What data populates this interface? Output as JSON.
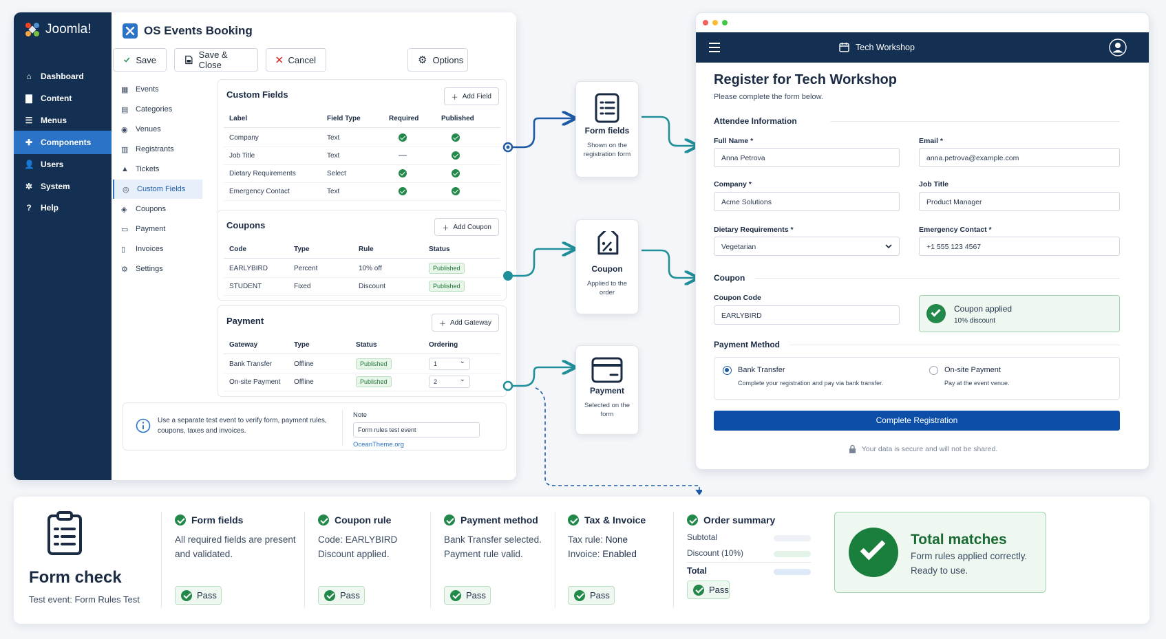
{
  "admin": {
    "brand": "Joomla!",
    "title": "OS Events Booking",
    "sidebar": [
      {
        "label": "Dashboard",
        "icon": "home-icon"
      },
      {
        "label": "Content",
        "icon": "file-icon"
      },
      {
        "label": "Menus",
        "icon": "list-icon"
      },
      {
        "label": "Components",
        "icon": "puzzle-icon",
        "active": true
      },
      {
        "label": "Users",
        "icon": "users-icon"
      },
      {
        "label": "System",
        "icon": "wrench-icon"
      },
      {
        "label": "Help",
        "icon": "question-icon"
      }
    ],
    "toolbar": {
      "save": "Save",
      "save_close": "Save & Close",
      "cancel": "Cancel",
      "options": "Options"
    },
    "nav": [
      "Events",
      "Categories",
      "Venues",
      "Registrants",
      "Tickets",
      "Custom Fields",
      "Coupons",
      "Payment",
      "Invoices",
      "Settings"
    ],
    "nav_active": "Custom Fields",
    "custom_fields": {
      "title": "Custom Fields",
      "add_button": "Add Field",
      "headers": [
        "Label",
        "Field Type",
        "Required",
        "Published"
      ],
      "rows": [
        {
          "label": "Company",
          "type": "Text",
          "required": true,
          "published": true
        },
        {
          "label": "Job Title",
          "type": "Text",
          "required": false,
          "published": true
        },
        {
          "label": "Dietary Requirements",
          "type": "Select",
          "required": true,
          "published": true
        },
        {
          "label": "Emergency Contact",
          "type": "Text",
          "required": true,
          "published": true
        }
      ]
    },
    "coupons": {
      "title": "Coupons",
      "add_button": "Add Coupon",
      "headers": [
        "Code",
        "Type",
        "Rule",
        "Status"
      ],
      "rows": [
        {
          "code": "EARLYBIRD",
          "type": "Percent",
          "rule": "10% off",
          "status": "Published"
        },
        {
          "code": "STUDENT",
          "type": "Fixed",
          "rule": "Discount",
          "status": "Published"
        }
      ]
    },
    "payment": {
      "title": "Payment",
      "add_button": "Add Gateway",
      "headers": [
        "Gateway",
        "Type",
        "Status",
        "Ordering"
      ],
      "rows": [
        {
          "gateway": "Bank Transfer",
          "type": "Offline",
          "status": "Published",
          "ordering": "1"
        },
        {
          "gateway": "On-site Payment",
          "type": "Offline",
          "status": "Published",
          "ordering": "2"
        }
      ]
    },
    "info": {
      "text": "Use a separate test event to verify form, payment rules, coupons, taxes and invoices.",
      "note_label": "Note",
      "note_value": "Form rules test event",
      "link": "OceanTheme.org"
    }
  },
  "flow": [
    {
      "title": "Form fields",
      "subtitle": "Shown on the registration form",
      "icon": "form-list-icon"
    },
    {
      "title": "Coupon",
      "subtitle": "Applied to the order",
      "icon": "coupon-tag-icon"
    },
    {
      "title": "Payment",
      "subtitle": "Selected on the form",
      "icon": "credit-card-icon"
    }
  ],
  "register": {
    "header_title": "Tech Workshop",
    "title": "Register for Tech Workshop",
    "subtitle": "Please complete the form below.",
    "attendee_section": "Attendee Information",
    "fields": {
      "full_name": {
        "label": "Full Name *",
        "value": "Anna Petrova"
      },
      "email": {
        "label": "Email *",
        "value": "anna.petrova@example.com"
      },
      "company": {
        "label": "Company *",
        "value": "Acme Solutions"
      },
      "job_title": {
        "label": "Job Title",
        "value": "Product Manager"
      },
      "dietary": {
        "label": "Dietary Requirements *",
        "value": "Vegetarian"
      },
      "emergency": {
        "label": "Emergency Contact *",
        "value": "+1 555 123 4567"
      }
    },
    "coupon_section": "Coupon",
    "coupon_label": "Coupon Code",
    "coupon_value": "EARLYBIRD",
    "coupon_applied": "Coupon applied",
    "coupon_discount": "10% discount",
    "payment_section": "Payment Method",
    "payment_options": [
      {
        "label": "Bank Transfer",
        "desc": "Complete your registration and pay via bank transfer.",
        "selected": true
      },
      {
        "label": "On-site Payment",
        "desc": "Pay at the event venue.",
        "selected": false
      }
    ],
    "submit": "Complete Registration",
    "secure_note": "Your data is secure and will not be shared."
  },
  "check": {
    "title": "Form check",
    "subtitle": "Test event: Form Rules Test",
    "pass_label": "Pass",
    "form_fields": {
      "title": "Form fields",
      "line1": "All required fields are present",
      "line2": "and validated."
    },
    "coupon_rule": {
      "title": "Coupon rule",
      "line1": "Code: EARLYBIRD",
      "line2": "Discount applied."
    },
    "payment_method": {
      "title": "Payment method",
      "line1": "Bank Transfer selected.",
      "line2": "Payment rule valid."
    },
    "tax_invoice": {
      "title": "Tax & Invoice",
      "line1_label": "Tax rule: ",
      "line1_value": "None",
      "line2_label": "Invoice: ",
      "line2_value": "Enabled"
    },
    "order_summary": {
      "title": "Order summary",
      "subtotal": "Subtotal",
      "discount": "Discount (10%)",
      "total": "Total"
    },
    "result": {
      "title": "Total matches",
      "line1": "Form rules applied correctly.",
      "line2": "Ready to use."
    }
  },
  "colors": {
    "navy": "#132f52",
    "accent": "#2b73c6",
    "green": "#22894a",
    "teal": "#1f8f9a",
    "button": "#0d4fa8"
  }
}
